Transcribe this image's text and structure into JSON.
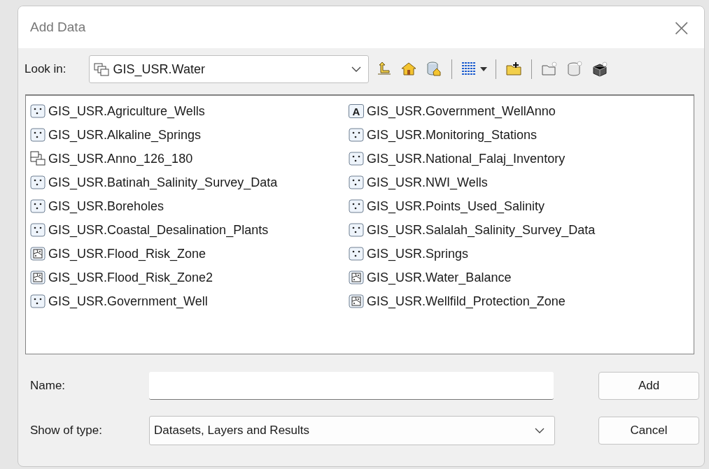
{
  "window": {
    "title": "Add Data",
    "close": "×"
  },
  "look_in": {
    "label": "Look in:",
    "value": "GIS_USR.Water"
  },
  "items": [
    {
      "name": "GIS_USR.Agriculture_Wells",
      "kind": "point"
    },
    {
      "name": "GIS_USR.Alkaline_Springs",
      "kind": "point"
    },
    {
      "name": "GIS_USR.Anno_126_180",
      "kind": "dataset"
    },
    {
      "name": "GIS_USR.Batinah_Salinity_Survey_Data",
      "kind": "point"
    },
    {
      "name": "GIS_USR.Boreholes",
      "kind": "point"
    },
    {
      "name": "GIS_USR.Coastal_Desalination_Plants",
      "kind": "point"
    },
    {
      "name": "GIS_USR.Flood_Risk_Zone",
      "kind": "polygon"
    },
    {
      "name": "GIS_USR.Flood_Risk_Zone2",
      "kind": "polygon"
    },
    {
      "name": "GIS_USR.Government_Well",
      "kind": "point"
    },
    {
      "name": "GIS_USR.Government_WellAnno",
      "kind": "annotation",
      "badge": "A"
    },
    {
      "name": "GIS_USR.Monitoring_Stations",
      "kind": "point"
    },
    {
      "name": "GIS_USR.National_Falaj_Inventory",
      "kind": "point"
    },
    {
      "name": "GIS_USR.NWI_Wells",
      "kind": "point"
    },
    {
      "name": "GIS_USR.Points_Used_Salinity",
      "kind": "point"
    },
    {
      "name": "GIS_USR.Salalah_Salinity_Survey_Data",
      "kind": "point"
    },
    {
      "name": "GIS_USR.Springs",
      "kind": "point"
    },
    {
      "name": "GIS_USR.Water_Balance",
      "kind": "polygon"
    },
    {
      "name": "GIS_USR.Wellfild_Protection_Zone",
      "kind": "polygon"
    }
  ],
  "name_field": {
    "label": "Name:"
  },
  "type_field": {
    "label": "Show of type:",
    "value": "Datasets, Layers and Results"
  },
  "buttons": [
    "Add",
    "Cancel"
  ]
}
